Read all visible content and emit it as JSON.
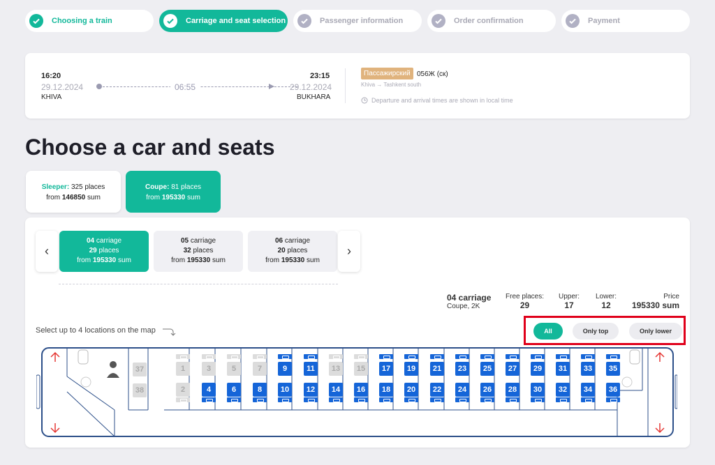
{
  "steps": [
    {
      "label": "Choosing a train",
      "state": "done"
    },
    {
      "label": "Carriage and seat selection",
      "state": "active"
    },
    {
      "label": "Passenger information",
      "state": "pending"
    },
    {
      "label": "Order confirmation",
      "state": "pending"
    },
    {
      "label": "Payment",
      "state": "pending"
    }
  ],
  "trip": {
    "dep_time": "16:20",
    "dep_date": "29.12.2024",
    "dep_city": "KHIVA",
    "duration": "06:55",
    "arr_time": "23:15",
    "arr_date": "29.12.2024",
    "arr_city": "BUKHARA",
    "train_type": "Пассажирский",
    "train_number": "056Ж (ск)",
    "route": "Khiva → Tashkent south",
    "time_note": "Departure and arrival times are shown in local time"
  },
  "page_title": "Choose a car and seats",
  "car_types": [
    {
      "name": "Sleeper:",
      "places": "325 places",
      "from": "from",
      "price": "146850",
      "currency": "sum"
    },
    {
      "name": "Coupe:",
      "places": "81 places",
      "from": "from",
      "price": "195330",
      "currency": "sum"
    }
  ],
  "carriages": [
    {
      "number": "04",
      "word": "carriage",
      "places_num": "29",
      "places_word": "places",
      "from": "from",
      "price": "195330",
      "currency": "sum"
    },
    {
      "number": "05",
      "word": "carriage",
      "places_num": "32",
      "places_word": "places",
      "from": "from",
      "price": "195330",
      "currency": "sum"
    },
    {
      "number": "06",
      "word": "carriage",
      "places_num": "20",
      "places_word": "places",
      "from": "from",
      "price": "195330",
      "currency": "sum"
    }
  ],
  "nav": {
    "prev": "‹",
    "next": "›"
  },
  "carriage_info": {
    "title": "04 carriage",
    "subtitle": "Coupe, 2K",
    "free_label": "Free places:",
    "free_value": "29",
    "upper_label": "Upper:",
    "upper_value": "17",
    "lower_label": "Lower:",
    "lower_value": "12",
    "price_label": "Price",
    "price_value": "195330 sum"
  },
  "select_hint": "Select up to 4 locations on the map",
  "filters": {
    "all": "All",
    "top": "Only top",
    "lower": "Only lower"
  },
  "colors": {
    "accent": "#12b89a",
    "seat_free": "#1565d8",
    "seat_busy": "#dcdcdc",
    "highlight": "#e0001a"
  },
  "seatmap": {
    "side_upper": "37",
    "side_lower": "38",
    "upper": [
      {
        "n": "1",
        "free": false
      },
      {
        "n": "3",
        "free": false
      },
      {
        "n": "5",
        "free": false
      },
      {
        "n": "7",
        "free": false
      },
      {
        "n": "9",
        "free": true
      },
      {
        "n": "11",
        "free": true
      },
      {
        "n": "13",
        "free": false
      },
      {
        "n": "15",
        "free": false
      },
      {
        "n": "17",
        "free": true
      },
      {
        "n": "19",
        "free": true
      },
      {
        "n": "21",
        "free": true
      },
      {
        "n": "23",
        "free": true
      },
      {
        "n": "25",
        "free": true
      },
      {
        "n": "27",
        "free": true
      },
      {
        "n": "29",
        "free": true
      },
      {
        "n": "31",
        "free": true
      },
      {
        "n": "33",
        "free": true
      },
      {
        "n": "35",
        "free": true
      }
    ],
    "lower": [
      {
        "n": "2",
        "free": false
      },
      {
        "n": "4",
        "free": true
      },
      {
        "n": "6",
        "free": true
      },
      {
        "n": "8",
        "free": true
      },
      {
        "n": "10",
        "free": true
      },
      {
        "n": "12",
        "free": true
      },
      {
        "n": "14",
        "free": true
      },
      {
        "n": "16",
        "free": true
      },
      {
        "n": "18",
        "free": true
      },
      {
        "n": "20",
        "free": true
      },
      {
        "n": "22",
        "free": true
      },
      {
        "n": "24",
        "free": true
      },
      {
        "n": "26",
        "free": true
      },
      {
        "n": "28",
        "free": true
      },
      {
        "n": "30",
        "free": true
      },
      {
        "n": "32",
        "free": true
      },
      {
        "n": "34",
        "free": true
      },
      {
        "n": "36",
        "free": true
      }
    ]
  }
}
